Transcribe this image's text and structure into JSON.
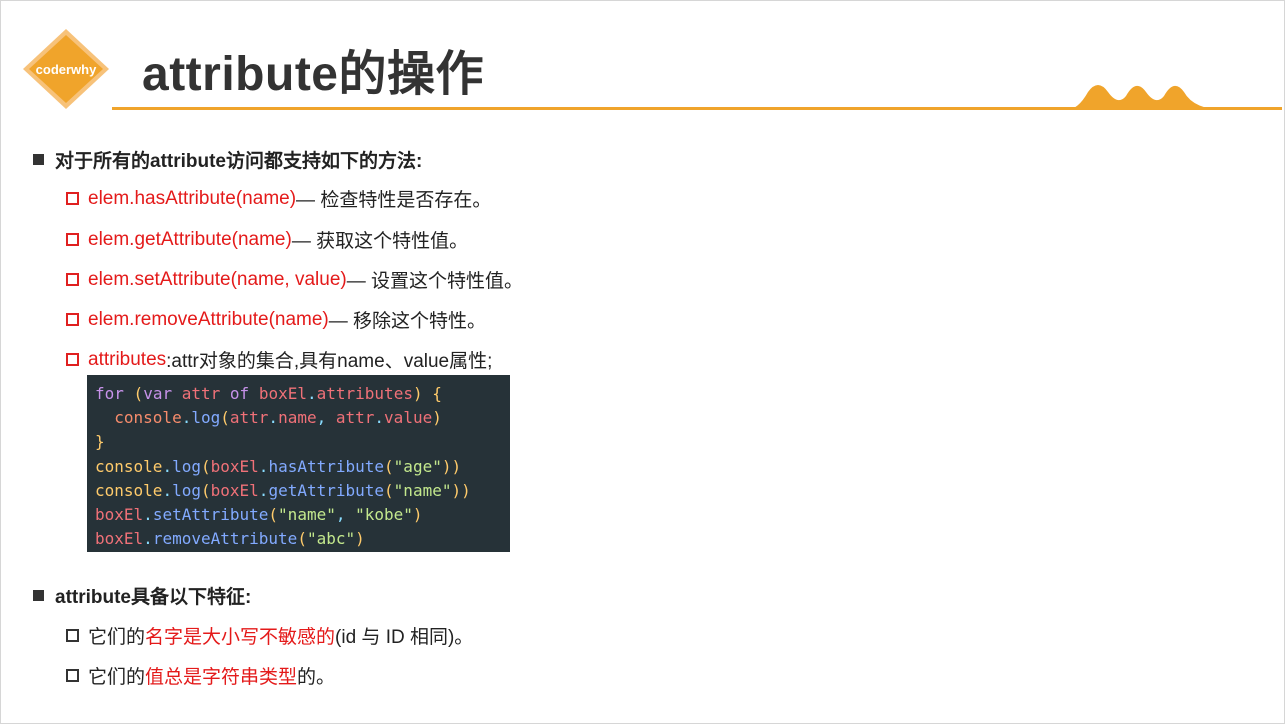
{
  "header": {
    "logo_text": "coderwhy",
    "title": "attribute的操作"
  },
  "section1": {
    "heading": "对于所有的attribute访问都支持如下的方法:",
    "items": [
      {
        "code": "elem.hasAttribute(name)",
        "desc": " — 检查特性是否存在。"
      },
      {
        "code": "elem.getAttribute(name)",
        "desc": " — 获取这个特性值。"
      },
      {
        "code": "elem.setAttribute(name, value)",
        "desc": " — 设置这个特性值。"
      },
      {
        "code": "elem.removeAttribute(name)",
        "desc": " — 移除这个特性。"
      },
      {
        "code": "attributes",
        "desc": ":attr对象的集合,具有name、value属性;"
      }
    ]
  },
  "code_block": {
    "t": {
      "for": "for",
      "var": "var",
      "attr": "attr",
      "of": "of",
      "boxEl": "boxEl",
      "attributes": "attributes",
      "console": "console",
      "log": "log",
      "name": "name",
      "value": "value",
      "hasAttribute": "hasAttribute",
      "getAttribute": "getAttribute",
      "setAttribute": "setAttribute",
      "removeAttribute": "removeAttribute",
      "s_age": "\"age\"",
      "s_name": "\"name\"",
      "s_kobe": "\"kobe\"",
      "s_abc": "\"abc\""
    }
  },
  "section2": {
    "heading": "attribute具备以下特征:",
    "items": [
      {
        "pre": "它们的",
        "hl": "名字是大小写不敏感的",
        "post": "(id 与 ID 相同)。"
      },
      {
        "pre": "它们的",
        "hl": "值总是字符串类型",
        "post": "的。"
      }
    ]
  },
  "colors": {
    "accent": "#f0a42b",
    "highlight": "#e41a1a",
    "code_bg": "#263238"
  }
}
